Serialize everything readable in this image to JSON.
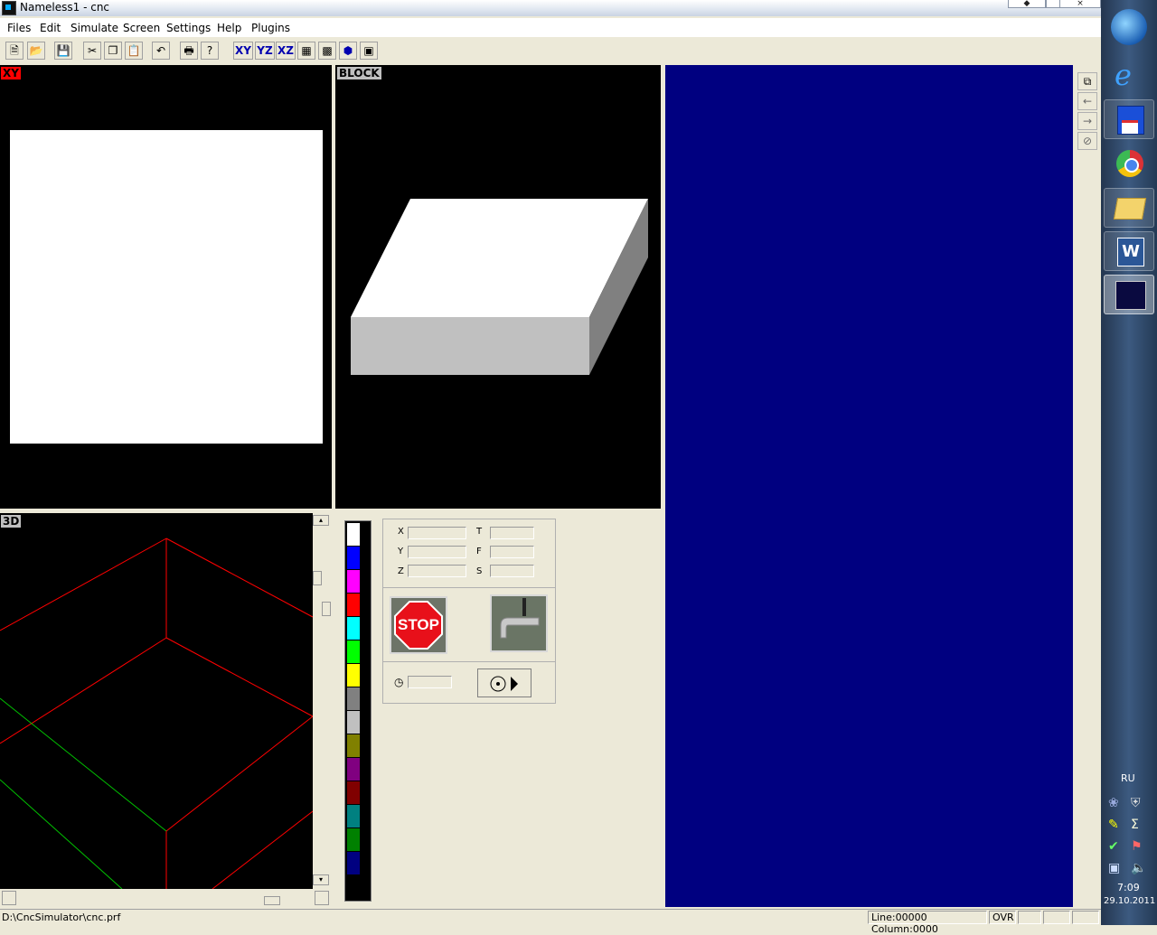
{
  "window": {
    "title": "Nameless1 - cnc"
  },
  "menu": [
    "Files",
    "Edit",
    "Simulate",
    "Screen",
    "Settings",
    "Help",
    "Plugins"
  ],
  "toolbar": {
    "icons": [
      "new-file-icon",
      "open-folder-icon",
      "save-icon",
      "cut-icon",
      "copy-icon",
      "paste-icon",
      "undo-icon",
      "print-icon",
      "help-icon"
    ],
    "view_buttons": [
      "XY",
      "YZ",
      "XZ"
    ]
  },
  "views": {
    "xy": "XY",
    "block": "BLOCK",
    "d3": "3D"
  },
  "coords": {
    "left": [
      "X",
      "Y",
      "Z"
    ],
    "right": [
      "T",
      "F",
      "S"
    ]
  },
  "controls": {
    "stop": "STOP"
  },
  "palette": [
    "#ffffff",
    "#0000ff",
    "#ff00ff",
    "#ff0000",
    "#00ffff",
    "#00ff00",
    "#ffff00",
    "#808080",
    "#c0c0c0",
    "#808000",
    "#800080",
    "#800000",
    "#008080",
    "#008000",
    "#000080"
  ],
  "status": {
    "path": "D:\\CncSimulator\\cnc.prf",
    "position": "Line:00000 Column:0000",
    "mode": "OVR"
  },
  "tray": {
    "lang": "RU",
    "time": "7:09",
    "date": "29.10.2011"
  }
}
